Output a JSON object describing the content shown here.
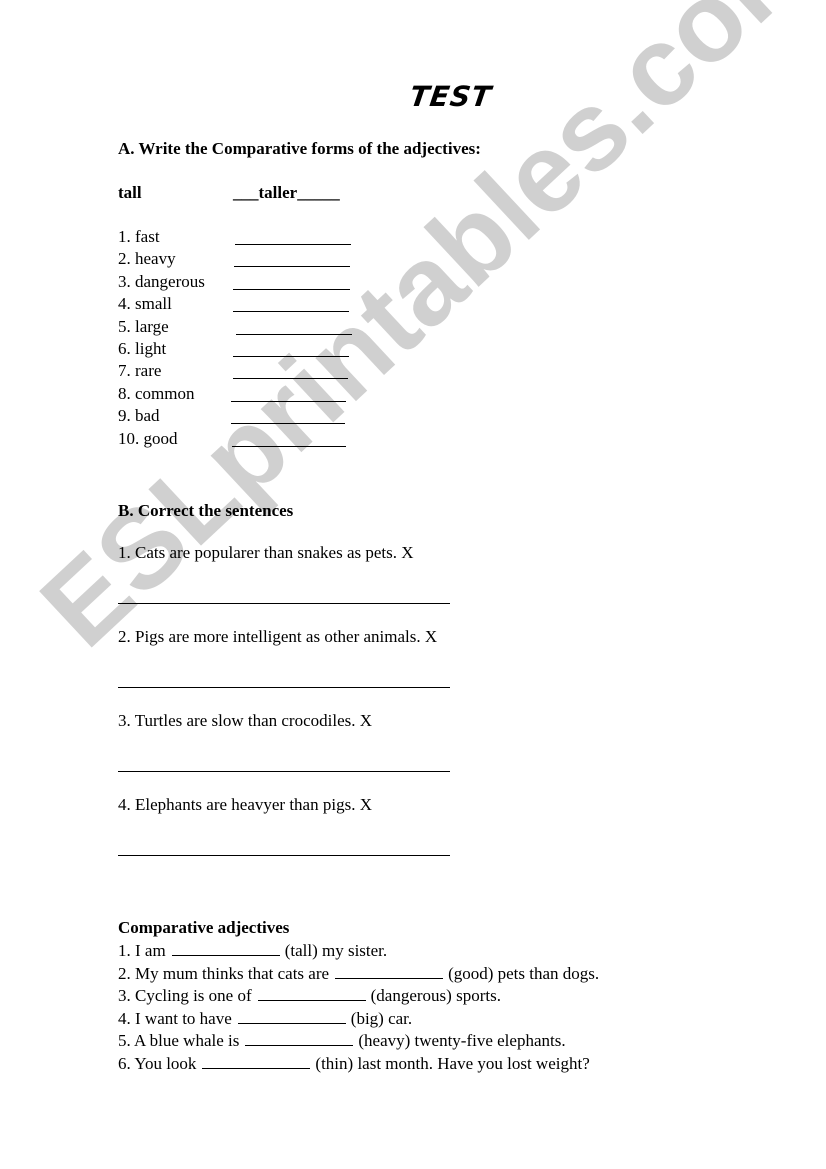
{
  "title": "TEST",
  "watermark": "ESLprintables.com",
  "section_a": {
    "heading": "A. Write the Comparative forms of the adjectives:",
    "example": {
      "word": "tall",
      "answer": "___taller_____"
    },
    "items": [
      {
        "label": "1. fast"
      },
      {
        "label": "2. heavy"
      },
      {
        "label": "3. dangerous"
      },
      {
        "label": "4. small"
      },
      {
        "label": "5. large"
      },
      {
        "label": "6. light"
      },
      {
        "label": "7. rare"
      },
      {
        "label": "8. common"
      },
      {
        "label": "9. bad"
      },
      {
        "label": "10. good"
      }
    ]
  },
  "section_b": {
    "heading": "B. Correct the sentences",
    "items": [
      {
        "text": "1. Cats are popularer than snakes as pets. X"
      },
      {
        "text": "2. Pigs are more intelligent as other animals. X"
      },
      {
        "text": "3. Turtles are slow than crocodiles. X"
      },
      {
        "text": "4. Elephants are heavyer than pigs. X"
      }
    ]
  },
  "section_c": {
    "heading": "Comparative adjectives",
    "items": [
      {
        "before": "1. I am",
        "after": "(tall) my sister."
      },
      {
        "before": "2. My mum thinks that cats are",
        "after": "(good) pets than dogs."
      },
      {
        "before": "3. Cycling is one of",
        "after": "(dangerous) sports."
      },
      {
        "before": "4. I want to have",
        "after": "(big) car."
      },
      {
        "before": "5. A blue whale is",
        "after": "(heavy) twenty-five elephants."
      },
      {
        "before": "6. You look",
        "after": "(thin) last month. Have you lost weight?"
      }
    ]
  }
}
